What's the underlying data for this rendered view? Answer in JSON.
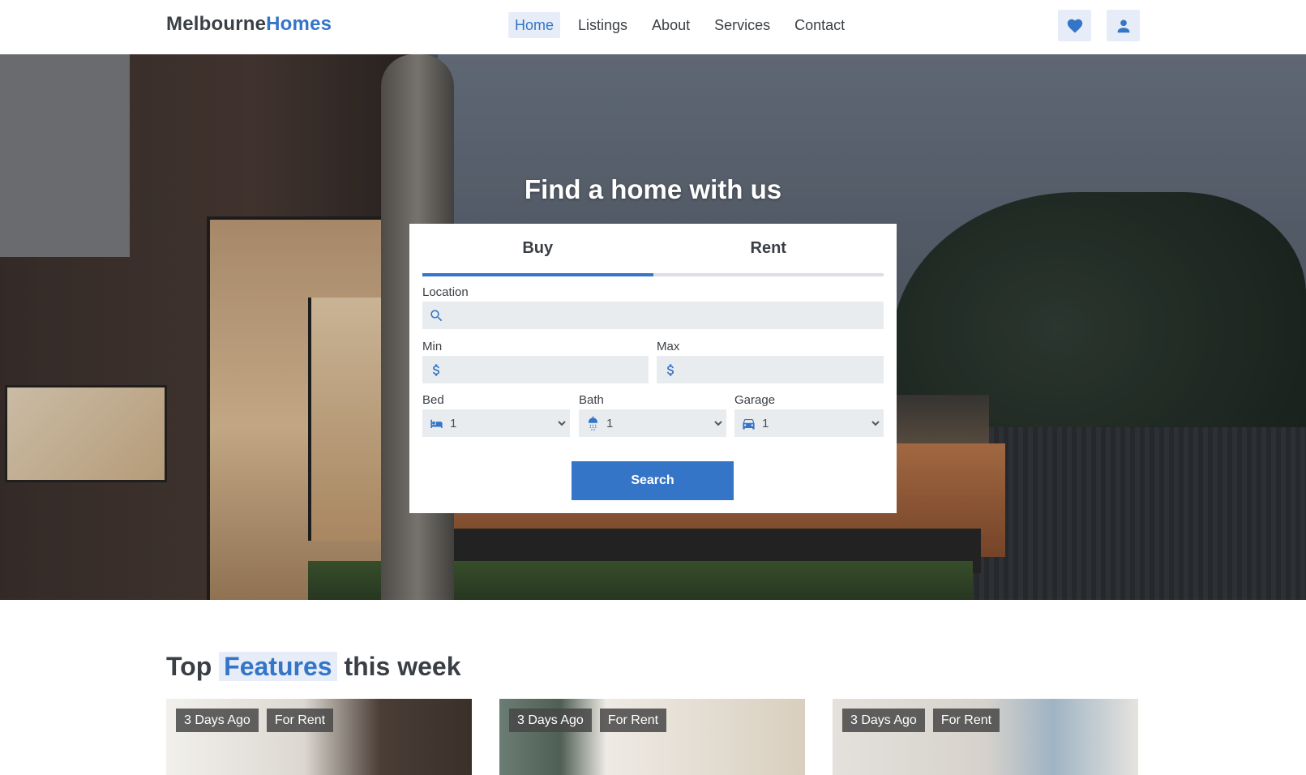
{
  "header": {
    "logo_primary": "Melbourne",
    "logo_accent": "Homes",
    "nav": [
      {
        "label": "Home",
        "active": true
      },
      {
        "label": "Listings",
        "active": false
      },
      {
        "label": "About",
        "active": false
      },
      {
        "label": "Services",
        "active": false
      },
      {
        "label": "Contact",
        "active": false
      }
    ],
    "icons": {
      "favorites": "heart-icon",
      "account": "user-icon"
    }
  },
  "hero": {
    "title": "Find a home with us"
  },
  "search": {
    "tabs": [
      {
        "label": "Buy",
        "active": true
      },
      {
        "label": "Rent",
        "active": false
      }
    ],
    "location_label": "Location",
    "location_value": "",
    "min_label": "Min",
    "min_value": "",
    "max_label": "Max",
    "max_value": "",
    "bed_label": "Bed",
    "bed_value": "1",
    "bath_label": "Bath",
    "bath_value": "1",
    "garage_label": "Garage",
    "garage_value": "1",
    "button_label": "Search"
  },
  "features": {
    "title_before": "Top",
    "title_highlight": "Features",
    "title_after": "this week",
    "listings": [
      {
        "age": "3 Days Ago",
        "type": "For Rent"
      },
      {
        "age": "3 Days Ago",
        "type": "For Rent"
      },
      {
        "age": "3 Days Ago",
        "type": "For Rent"
      }
    ]
  },
  "colors": {
    "accent": "#3475c8",
    "accent_light": "#e6edf8",
    "text": "#3a3f45",
    "field_bg": "#e9ecef"
  }
}
